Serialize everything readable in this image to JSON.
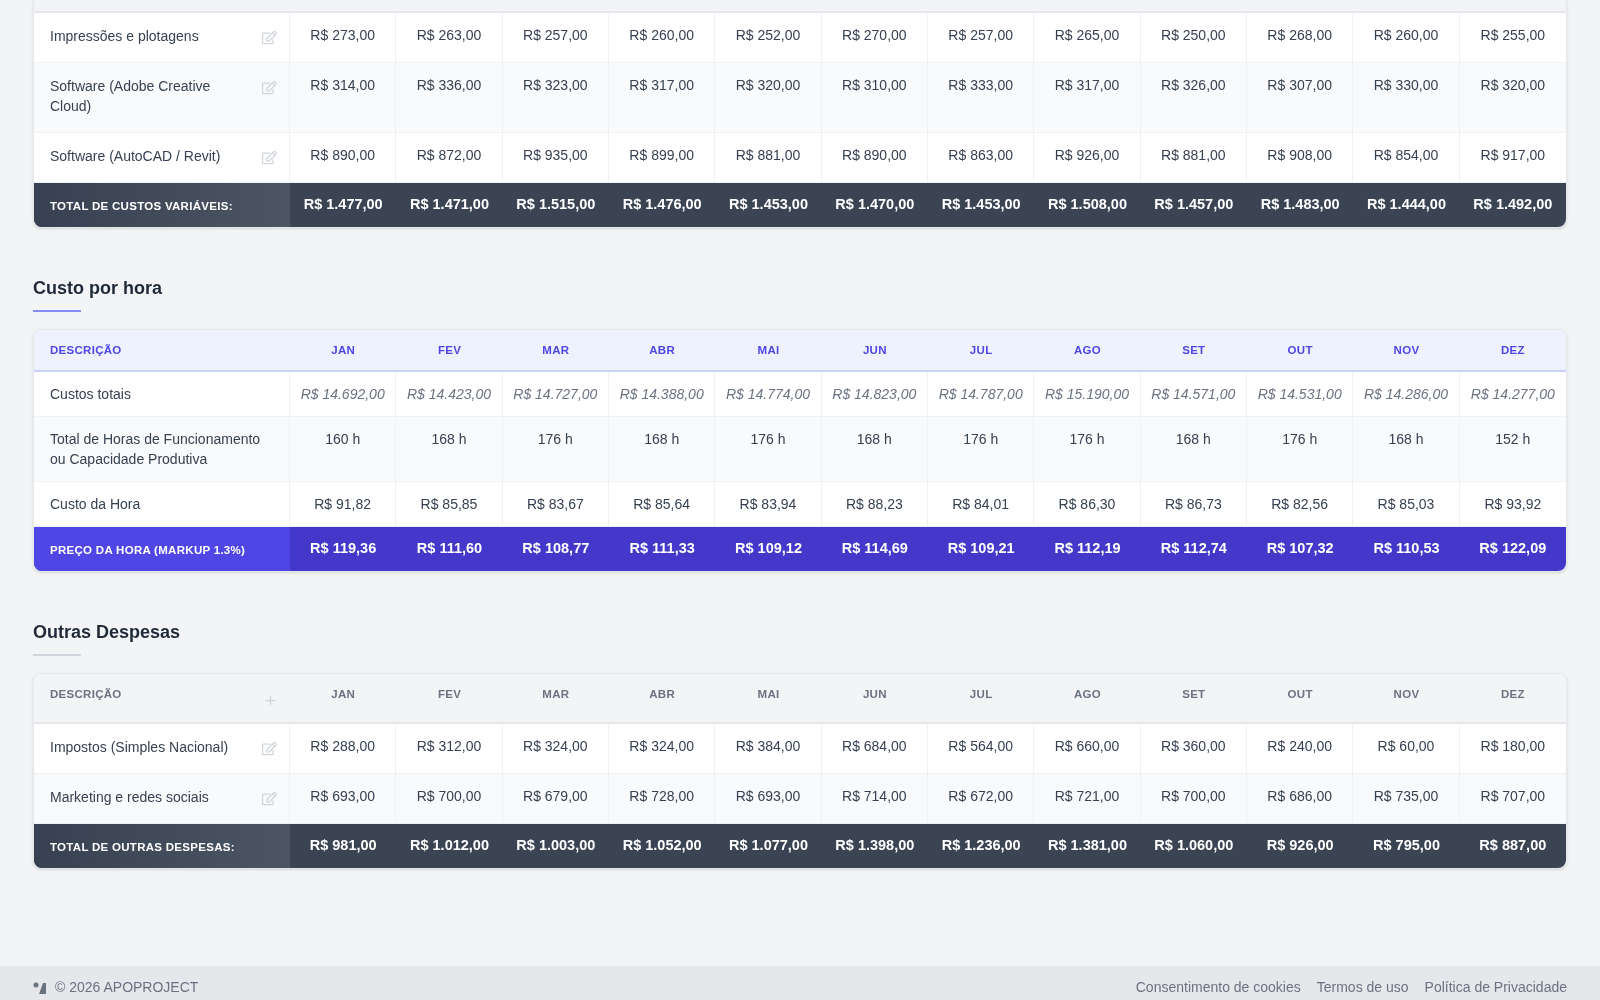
{
  "variable_costs": {
    "rows": [
      {
        "label": "Impressões e plotagens",
        "editable": true,
        "values": [
          "R$ 273,00",
          "R$ 263,00",
          "R$ 257,00",
          "R$ 260,00",
          "R$ 252,00",
          "R$ 270,00",
          "R$ 257,00",
          "R$ 265,00",
          "R$ 250,00",
          "R$ 268,00",
          "R$ 260,00",
          "R$ 255,00"
        ]
      },
      {
        "label": "Software (Adobe Creative Cloud)",
        "editable": true,
        "values": [
          "R$ 314,00",
          "R$ 336,00",
          "R$ 323,00",
          "R$ 317,00",
          "R$ 320,00",
          "R$ 310,00",
          "R$ 333,00",
          "R$ 317,00",
          "R$ 326,00",
          "R$ 307,00",
          "R$ 330,00",
          "R$ 320,00"
        ]
      },
      {
        "label": "Software (AutoCAD / Revit)",
        "editable": true,
        "values": [
          "R$ 890,00",
          "R$ 872,00",
          "R$ 935,00",
          "R$ 899,00",
          "R$ 881,00",
          "R$ 890,00",
          "R$ 863,00",
          "R$ 926,00",
          "R$ 881,00",
          "R$ 908,00",
          "R$ 854,00",
          "R$ 917,00"
        ]
      }
    ],
    "total": {
      "kind": "dark",
      "label": "TOTAL DE CUSTOS VARIÁVEIS:",
      "values": [
        "R$ 1.477,00",
        "R$ 1.471,00",
        "R$ 1.515,00",
        "R$ 1.476,00",
        "R$ 1.453,00",
        "R$ 1.470,00",
        "R$ 1.453,00",
        "R$ 1.508,00",
        "R$ 1.457,00",
        "R$ 1.483,00",
        "R$ 1.444,00",
        "R$ 1.492,00"
      ]
    }
  },
  "hourly_cost": {
    "title": "Custo por hora",
    "kind": "accent",
    "columns": [
      "DESCRIÇÃO",
      "JAN",
      "FEV",
      "MAR",
      "ABR",
      "MAI",
      "JUN",
      "JUL",
      "AGO",
      "SET",
      "OUT",
      "NOV",
      "DEZ"
    ],
    "rows": [
      {
        "label": "Custos totais",
        "italic": true,
        "values": [
          "R$ 14.692,00",
          "R$ 14.423,00",
          "R$ 14.727,00",
          "R$ 14.388,00",
          "R$ 14.774,00",
          "R$ 14.823,00",
          "R$ 14.787,00",
          "R$ 15.190,00",
          "R$ 14.571,00",
          "R$ 14.531,00",
          "R$ 14.286,00",
          "R$ 14.277,00"
        ]
      },
      {
        "label": "Total de Horas de Funcionamento ou Capacidade Produtiva",
        "italic": false,
        "values": [
          "160 h",
          "168 h",
          "176 h",
          "168 h",
          "176 h",
          "168 h",
          "176 h",
          "176 h",
          "168 h",
          "176 h",
          "168 h",
          "152 h"
        ]
      },
      {
        "label": "Custo da Hora",
        "italic": false,
        "values": [
          "R$ 91,82",
          "R$ 85,85",
          "R$ 83,67",
          "R$ 85,64",
          "R$ 83,94",
          "R$ 88,23",
          "R$ 84,01",
          "R$ 86,30",
          "R$ 86,73",
          "R$ 82,56",
          "R$ 85,03",
          "R$ 93,92"
        ]
      }
    ],
    "total": {
      "kind": "accent",
      "label": "PREÇO DA HORA (MARKUP 1.3%)",
      "values": [
        "R$ 119,36",
        "R$ 111,60",
        "R$ 108,77",
        "R$ 111,33",
        "R$ 109,12",
        "R$ 114,69",
        "R$ 109,21",
        "R$ 112,19",
        "R$ 112,74",
        "R$ 107,32",
        "R$ 110,53",
        "R$ 122,09"
      ]
    }
  },
  "other_expenses": {
    "title": "Outras Despesas",
    "kind": "plain",
    "add_button": true,
    "columns": [
      "DESCRIÇÃO",
      "JAN",
      "FEV",
      "MAR",
      "ABR",
      "MAI",
      "JUN",
      "JUL",
      "AGO",
      "SET",
      "OUT",
      "NOV",
      "DEZ"
    ],
    "rows": [
      {
        "label": "Impostos (Simples Nacional)",
        "editable": true,
        "values": [
          "R$ 288,00",
          "R$ 312,00",
          "R$ 324,00",
          "R$ 324,00",
          "R$ 384,00",
          "R$ 684,00",
          "R$ 564,00",
          "R$ 660,00",
          "R$ 360,00",
          "R$ 240,00",
          "R$ 60,00",
          "R$ 180,00"
        ]
      },
      {
        "label": "Marketing e redes sociais",
        "editable": true,
        "values": [
          "R$ 693,00",
          "R$ 700,00",
          "R$ 679,00",
          "R$ 728,00",
          "R$ 693,00",
          "R$ 714,00",
          "R$ 672,00",
          "R$ 721,00",
          "R$ 700,00",
          "R$ 686,00",
          "R$ 735,00",
          "R$ 707,00"
        ]
      }
    ],
    "total": {
      "kind": "dark",
      "label": "TOTAL DE OUTRAS DESPESAS:",
      "values": [
        "R$ 981,00",
        "R$ 1.012,00",
        "R$ 1.003,00",
        "R$ 1.052,00",
        "R$ 1.077,00",
        "R$ 1.398,00",
        "R$ 1.236,00",
        "R$ 1.381,00",
        "R$ 1.060,00",
        "R$ 926,00",
        "R$ 795,00",
        "R$ 887,00"
      ]
    }
  },
  "footer": {
    "copyright": "© 2026 APOPROJECT",
    "links": [
      "Consentimento de cookies",
      "Termos de uso",
      "Política de Privacidade"
    ]
  }
}
